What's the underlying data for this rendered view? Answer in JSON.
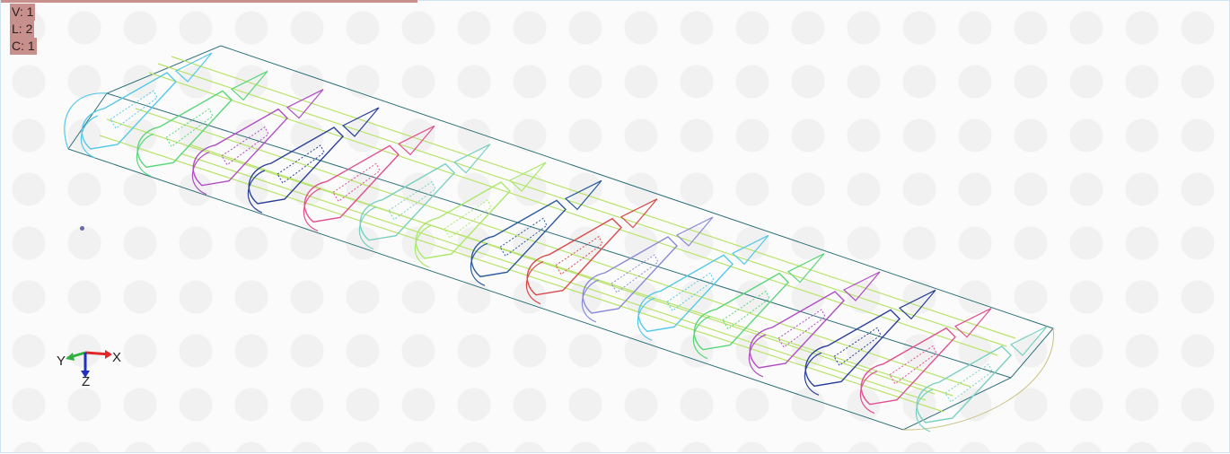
{
  "overlay": {
    "v_label": "V: 1",
    "l_label": "L: 2",
    "c_label": "C: 1"
  },
  "triad": {
    "x_label": "X",
    "y_label": "Y",
    "z_label": "Z",
    "x_color": "#e0282a",
    "y_color": "#30b040",
    "z_color": "#2030c0"
  },
  "colors": {
    "outline": "#2e6f7a",
    "spar": "#b9e36a",
    "rib_palette": [
      "#55c8e8",
      "#5ad67a",
      "#b04cc4",
      "#2a3f9a",
      "#e05090",
      "#7ad0c0",
      "#a8e86a",
      "#2a5a9a",
      "#d84a4a",
      "#8a8ad8"
    ]
  }
}
